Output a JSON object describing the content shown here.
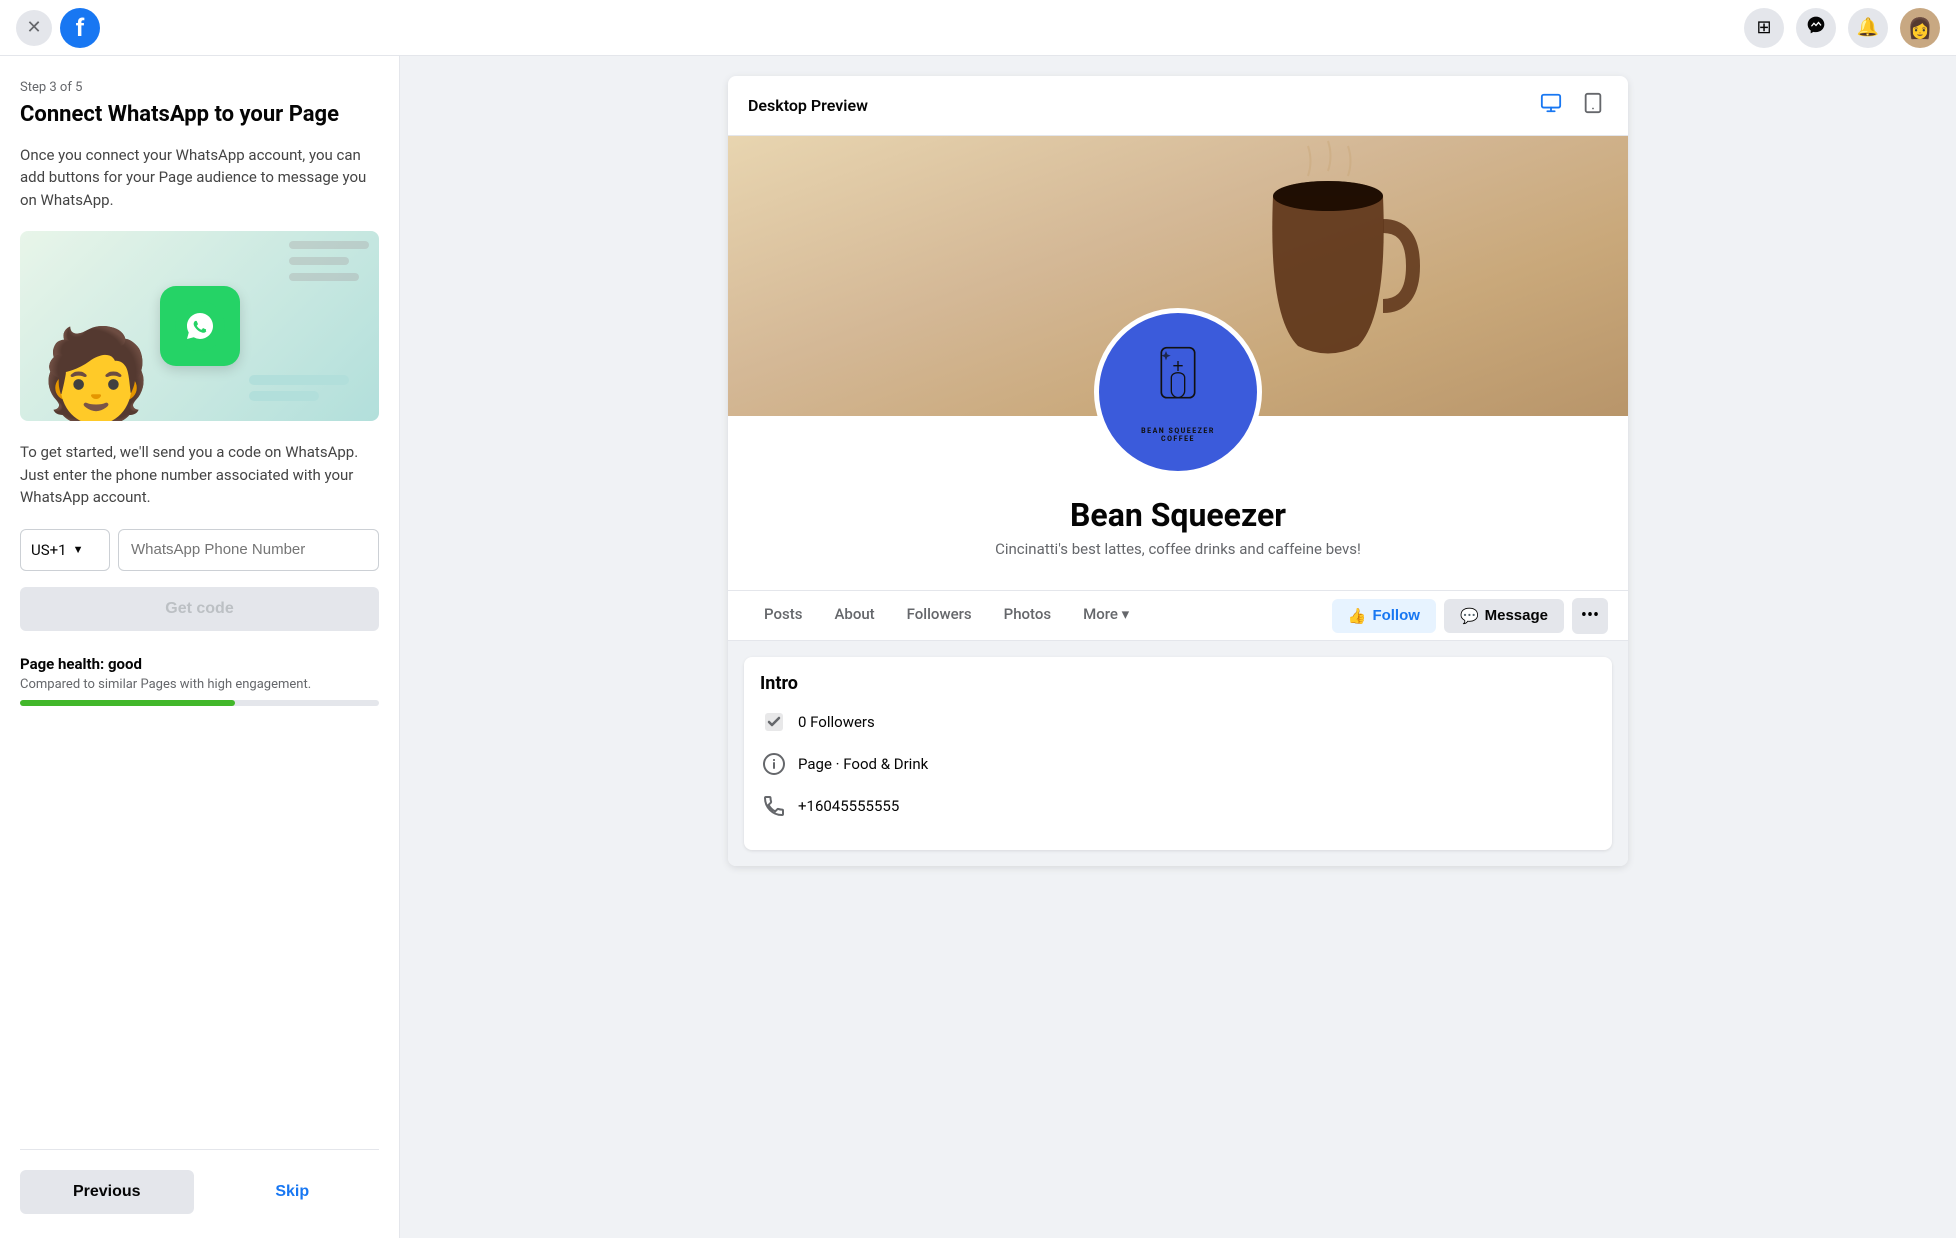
{
  "nav": {
    "close_label": "×",
    "fb_logo": "f",
    "grid_icon": "⊞",
    "messenger_icon": "💬",
    "bell_icon": "🔔",
    "avatar_emoji": "👩"
  },
  "left_panel": {
    "step_label": "Step 3 of 5",
    "title": "Connect WhatsApp to your Page",
    "description": "Once you connect your WhatsApp account, you can add buttons for your Page audience to message you on WhatsApp.",
    "send_code_desc": "To get started, we'll send you a code on WhatsApp. Just enter the phone number associated with your WhatsApp account.",
    "country_code": "US+1",
    "phone_placeholder": "WhatsApp Phone Number",
    "get_code_label": "Get code",
    "page_health_title": "Page health: good",
    "page_health_desc": "Compared to similar Pages with high engagement.",
    "health_bar_percent": 60,
    "prev_label": "Previous",
    "skip_label": "Skip"
  },
  "right_panel": {
    "preview_title": "Desktop Preview",
    "desktop_icon": "🖥",
    "tablet_icon": "📱",
    "page": {
      "name": "Bean Squeezer",
      "tagline": "Cincinatti's best lattes, coffee drinks and caffeine bevs!",
      "nav_items": [
        "Posts",
        "About",
        "Followers",
        "Photos",
        "More"
      ],
      "follow_label": "Follow",
      "message_label": "Message",
      "intro_title": "Intro",
      "followers_count": "0 Followers",
      "page_category": "Page · Food & Drink",
      "phone_number": "+16045555555",
      "profile_brand_line1": "BEAN SQUEEZER",
      "profile_brand_line2": "COFFEE"
    }
  }
}
